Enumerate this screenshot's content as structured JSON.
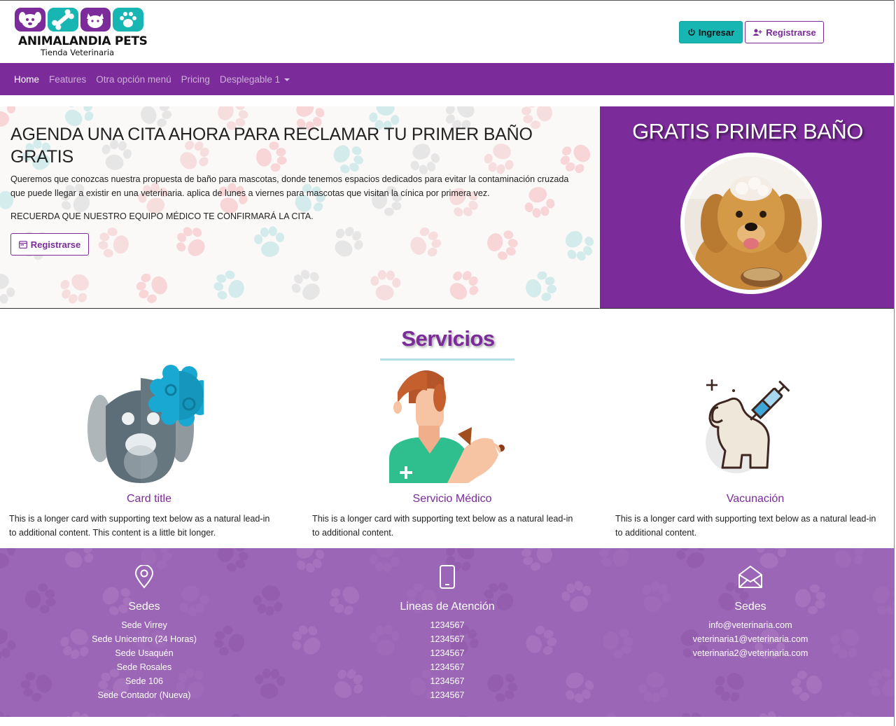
{
  "brand": {
    "name": "ANIMALANDIA PETS",
    "tagline": "Tienda Veterinaria",
    "colors": {
      "purple": "#7b2b9a",
      "teal": "#17b6b3",
      "lavender": "#9b66b5"
    }
  },
  "header": {
    "login_label": "Ingresar",
    "login_icon": "power-icon",
    "register_label": "Registrarse",
    "register_icon": "user-plus-icon"
  },
  "nav": {
    "items": [
      {
        "label": "Home",
        "active": true
      },
      {
        "label": "Features",
        "active": false
      },
      {
        "label": "Otra opción menú",
        "active": false
      },
      {
        "label": "Pricing",
        "active": false
      },
      {
        "label": "Desplegable 1",
        "active": false,
        "dropdown": true
      }
    ]
  },
  "hero": {
    "title": "AGENDA UNA CITA AHORA PARA RECLAMAR TU PRIMER BAÑO GRATIS",
    "paragraph": "Queremos que conozcas nuestra propuesta de baño para mascotas, donde tenemos espacios dedicados para evitar la contaminación cruzada que puede llegar a existir en una veterinaria. aplica de lunes a viernes para mascotas que visitan la cínica por primera vez.",
    "note": "RECUERDA QUE NUESTRO EQUIPO MÉDICO TE CONFIRMARÁ LA CITA.",
    "button_label": "Registrarse",
    "button_icon": "calendar-icon"
  },
  "promo": {
    "title": "GRATIS PRIMER BAÑO"
  },
  "services": {
    "title": "Servicios",
    "cards": [
      {
        "title": "Card title",
        "text": "This is a longer card with supporting text below as a natural lead-in to additional content. This content is a little bit longer.",
        "icon": "dog-bath-icon"
      },
      {
        "title": "Servicio Médico",
        "text": "This is a longer card with supporting text below as a natural lead-in to additional content.",
        "icon": "veterinarian-icon"
      },
      {
        "title": "Vacunación",
        "text": "This is a longer card with supporting text below as a natural lead-in to additional content.",
        "icon": "dog-vaccine-icon"
      }
    ]
  },
  "footer": {
    "columns": [
      {
        "title": "Sedes",
        "icon": "location-pin-icon",
        "lines": [
          "Sede Virrey",
          "Sede Unicentro (24 Horas)",
          "Sede Usaquén",
          "Sede Rosales",
          "Sede 106",
          "Sede Contador (Nueva)"
        ]
      },
      {
        "title": "Lineas de Atención",
        "icon": "phone-icon",
        "lines": [
          "1234567",
          "1234567",
          "1234567",
          "1234567",
          "1234567",
          "1234567"
        ]
      },
      {
        "title": "Sedes",
        "icon": "envelope-icon",
        "lines": [
          "info@veterinaria.com",
          "veterinaria1@veterinaria.com",
          "veterinaria2@veterinaria.com"
        ]
      }
    ]
  }
}
